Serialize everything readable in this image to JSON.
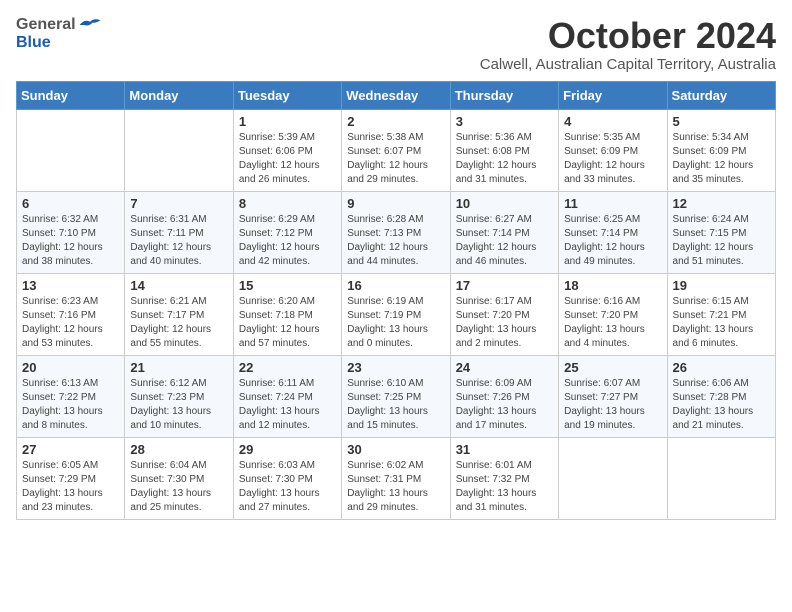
{
  "logo": {
    "general": "General",
    "blue": "Blue"
  },
  "header": {
    "month": "October 2024",
    "location": "Calwell, Australian Capital Territory, Australia"
  },
  "weekdays": [
    "Sunday",
    "Monday",
    "Tuesday",
    "Wednesday",
    "Thursday",
    "Friday",
    "Saturday"
  ],
  "weeks": [
    [
      {
        "day": "",
        "info": ""
      },
      {
        "day": "",
        "info": ""
      },
      {
        "day": "1",
        "info": "Sunrise: 5:39 AM\nSunset: 6:06 PM\nDaylight: 12 hours\nand 26 minutes."
      },
      {
        "day": "2",
        "info": "Sunrise: 5:38 AM\nSunset: 6:07 PM\nDaylight: 12 hours\nand 29 minutes."
      },
      {
        "day": "3",
        "info": "Sunrise: 5:36 AM\nSunset: 6:08 PM\nDaylight: 12 hours\nand 31 minutes."
      },
      {
        "day": "4",
        "info": "Sunrise: 5:35 AM\nSunset: 6:09 PM\nDaylight: 12 hours\nand 33 minutes."
      },
      {
        "day": "5",
        "info": "Sunrise: 5:34 AM\nSunset: 6:09 PM\nDaylight: 12 hours\nand 35 minutes."
      }
    ],
    [
      {
        "day": "6",
        "info": "Sunrise: 6:32 AM\nSunset: 7:10 PM\nDaylight: 12 hours\nand 38 minutes."
      },
      {
        "day": "7",
        "info": "Sunrise: 6:31 AM\nSunset: 7:11 PM\nDaylight: 12 hours\nand 40 minutes."
      },
      {
        "day": "8",
        "info": "Sunrise: 6:29 AM\nSunset: 7:12 PM\nDaylight: 12 hours\nand 42 minutes."
      },
      {
        "day": "9",
        "info": "Sunrise: 6:28 AM\nSunset: 7:13 PM\nDaylight: 12 hours\nand 44 minutes."
      },
      {
        "day": "10",
        "info": "Sunrise: 6:27 AM\nSunset: 7:14 PM\nDaylight: 12 hours\nand 46 minutes."
      },
      {
        "day": "11",
        "info": "Sunrise: 6:25 AM\nSunset: 7:14 PM\nDaylight: 12 hours\nand 49 minutes."
      },
      {
        "day": "12",
        "info": "Sunrise: 6:24 AM\nSunset: 7:15 PM\nDaylight: 12 hours\nand 51 minutes."
      }
    ],
    [
      {
        "day": "13",
        "info": "Sunrise: 6:23 AM\nSunset: 7:16 PM\nDaylight: 12 hours\nand 53 minutes."
      },
      {
        "day": "14",
        "info": "Sunrise: 6:21 AM\nSunset: 7:17 PM\nDaylight: 12 hours\nand 55 minutes."
      },
      {
        "day": "15",
        "info": "Sunrise: 6:20 AM\nSunset: 7:18 PM\nDaylight: 12 hours\nand 57 minutes."
      },
      {
        "day": "16",
        "info": "Sunrise: 6:19 AM\nSunset: 7:19 PM\nDaylight: 13 hours\nand 0 minutes."
      },
      {
        "day": "17",
        "info": "Sunrise: 6:17 AM\nSunset: 7:20 PM\nDaylight: 13 hours\nand 2 minutes."
      },
      {
        "day": "18",
        "info": "Sunrise: 6:16 AM\nSunset: 7:20 PM\nDaylight: 13 hours\nand 4 minutes."
      },
      {
        "day": "19",
        "info": "Sunrise: 6:15 AM\nSunset: 7:21 PM\nDaylight: 13 hours\nand 6 minutes."
      }
    ],
    [
      {
        "day": "20",
        "info": "Sunrise: 6:13 AM\nSunset: 7:22 PM\nDaylight: 13 hours\nand 8 minutes."
      },
      {
        "day": "21",
        "info": "Sunrise: 6:12 AM\nSunset: 7:23 PM\nDaylight: 13 hours\nand 10 minutes."
      },
      {
        "day": "22",
        "info": "Sunrise: 6:11 AM\nSunset: 7:24 PM\nDaylight: 13 hours\nand 12 minutes."
      },
      {
        "day": "23",
        "info": "Sunrise: 6:10 AM\nSunset: 7:25 PM\nDaylight: 13 hours\nand 15 minutes."
      },
      {
        "day": "24",
        "info": "Sunrise: 6:09 AM\nSunset: 7:26 PM\nDaylight: 13 hours\nand 17 minutes."
      },
      {
        "day": "25",
        "info": "Sunrise: 6:07 AM\nSunset: 7:27 PM\nDaylight: 13 hours\nand 19 minutes."
      },
      {
        "day": "26",
        "info": "Sunrise: 6:06 AM\nSunset: 7:28 PM\nDaylight: 13 hours\nand 21 minutes."
      }
    ],
    [
      {
        "day": "27",
        "info": "Sunrise: 6:05 AM\nSunset: 7:29 PM\nDaylight: 13 hours\nand 23 minutes."
      },
      {
        "day": "28",
        "info": "Sunrise: 6:04 AM\nSunset: 7:30 PM\nDaylight: 13 hours\nand 25 minutes."
      },
      {
        "day": "29",
        "info": "Sunrise: 6:03 AM\nSunset: 7:30 PM\nDaylight: 13 hours\nand 27 minutes."
      },
      {
        "day": "30",
        "info": "Sunrise: 6:02 AM\nSunset: 7:31 PM\nDaylight: 13 hours\nand 29 minutes."
      },
      {
        "day": "31",
        "info": "Sunrise: 6:01 AM\nSunset: 7:32 PM\nDaylight: 13 hours\nand 31 minutes."
      },
      {
        "day": "",
        "info": ""
      },
      {
        "day": "",
        "info": ""
      }
    ]
  ]
}
